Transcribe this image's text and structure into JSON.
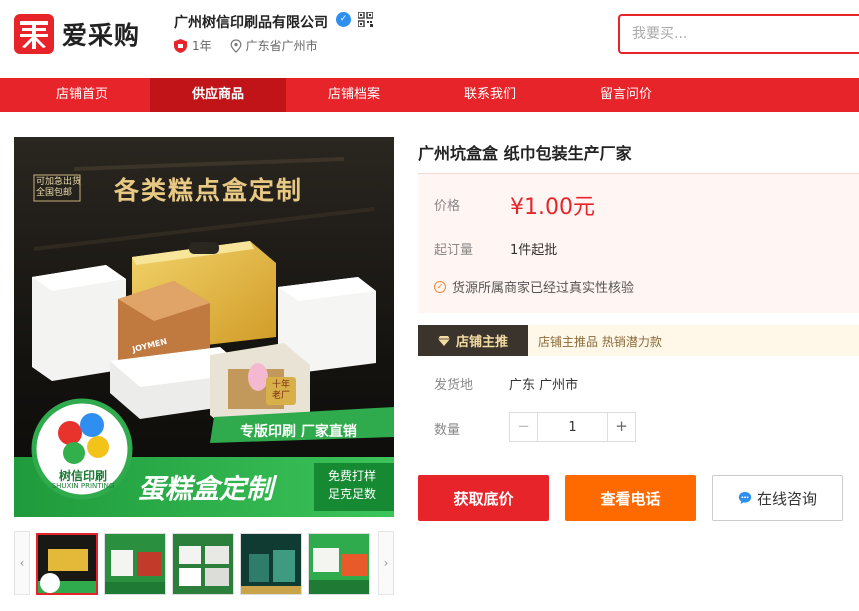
{
  "brand": {
    "logo_text": "爱采购",
    "accent": "#e8242b"
  },
  "shop": {
    "name": "广州树信印刷品有限公司",
    "years": "1年",
    "location": "广东省广州市"
  },
  "search": {
    "placeholder": "我要买..."
  },
  "nav": {
    "items": [
      {
        "label": "店铺首页"
      },
      {
        "label": "供应商品"
      },
      {
        "label": "店铺档案"
      },
      {
        "label": "联系我们"
      },
      {
        "label": "留言问价"
      }
    ],
    "active_index": 1
  },
  "gallery": {
    "main": {
      "corner_tag_line1": "可加急出货",
      "corner_tag_line2": "全国包邮",
      "headline": "各类糕点盒定制",
      "box_brand": "JOYMEN",
      "badge_line1": "十年",
      "badge_line2": "老厂",
      "slogan": "专版印刷  厂家直销",
      "logo_cn": "树信印刷",
      "logo_en": "SHUXIN PRINTING",
      "banner_main": "蛋糕盒定制",
      "banner_side1": "免费打样",
      "banner_side2": "足克足数"
    },
    "thumbnails": 5,
    "active_thumbnail": 0
  },
  "product": {
    "title": "广州坑盒盒 纸巾包装生产厂家",
    "price_label": "价格",
    "price": "¥1.00元",
    "moq_label": "起订量",
    "moq": "1件起批",
    "verified_text": "货源所属商家已经过真实性核验",
    "promo_badge": "店铺主推",
    "promo_text": "店铺主推品 热销潜力款",
    "ship_label": "发货地",
    "ship_from": "广东 广州市",
    "qty_label": "数量",
    "quantity": "1"
  },
  "actions": {
    "quote": "获取底价",
    "phone": "查看电话",
    "chat": "在线咨询"
  }
}
